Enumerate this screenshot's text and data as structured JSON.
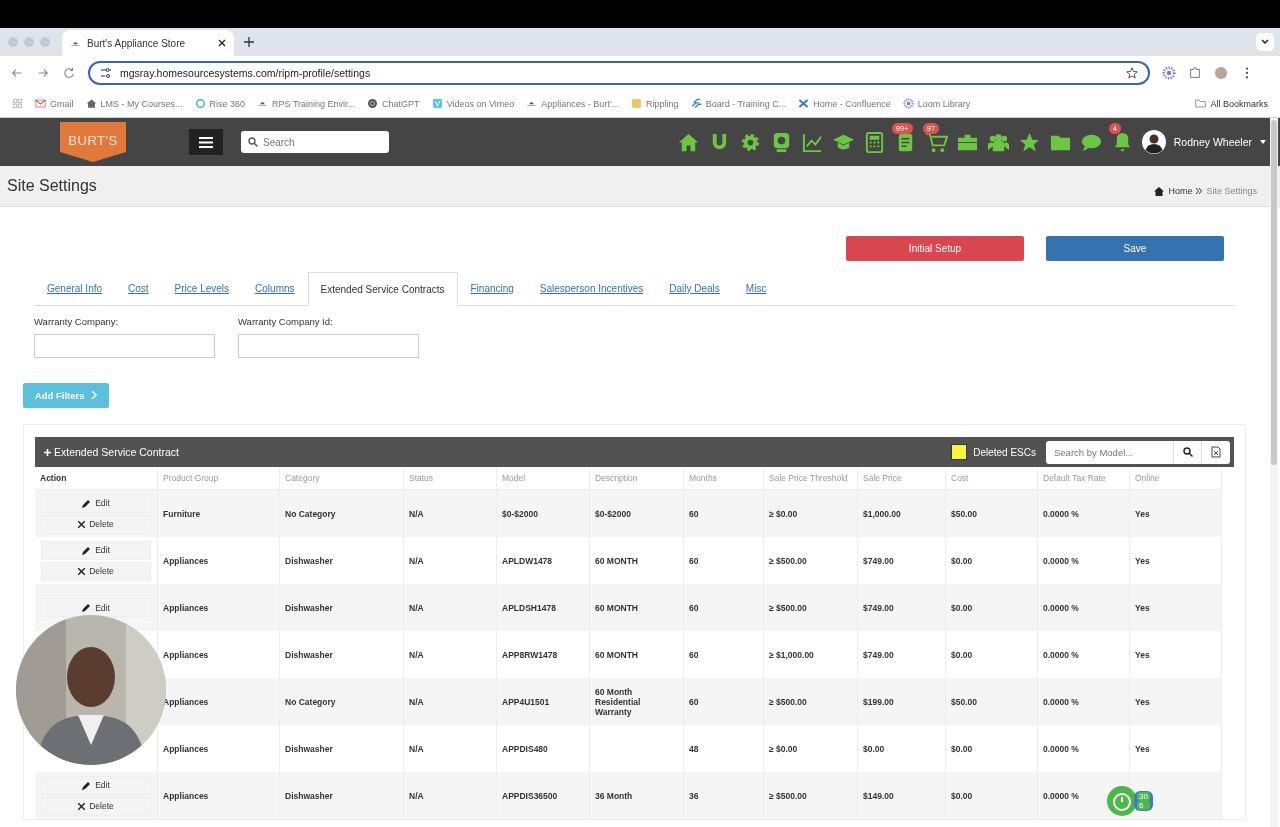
{
  "browser": {
    "tab_title": "Burt's Appliance Store",
    "url": "mgsray.homesourcesystems.com/ripm-profile/settings",
    "bookmarks": [
      {
        "label": "Gmail",
        "kind": "mail"
      },
      {
        "label": "LMS - My Courses...",
        "kind": "house"
      },
      {
        "label": "Rise 360",
        "kind": "ring"
      },
      {
        "label": "RPS Training Envir...",
        "kind": "hat"
      },
      {
        "label": "ChatGPT",
        "kind": "knot"
      },
      {
        "label": "Videos on Vimeo",
        "kind": "video"
      },
      {
        "label": "Appliances - Burt'...",
        "kind": "hat"
      },
      {
        "label": "Rippling",
        "kind": "tile"
      },
      {
        "label": "Board - Training C...",
        "kind": "board"
      },
      {
        "label": "Home - Confluence",
        "kind": "cross"
      },
      {
        "label": "Loom Library",
        "kind": "burst"
      }
    ],
    "all_bookmarks": "All Bookmarks"
  },
  "header": {
    "logo": "BURT'S",
    "search_placeholder": "Search",
    "icons": [
      {
        "kind": "home"
      },
      {
        "kind": "magnet"
      },
      {
        "kind": "gear"
      },
      {
        "kind": "webcam"
      },
      {
        "kind": "chart"
      },
      {
        "kind": "cap"
      },
      {
        "kind": "calculator"
      },
      {
        "kind": "notebook",
        "badge": "99+"
      },
      {
        "kind": "cart",
        "badge": "97"
      },
      {
        "kind": "briefcase"
      },
      {
        "kind": "group"
      },
      {
        "kind": "star"
      },
      {
        "kind": "folder"
      },
      {
        "kind": "chat"
      },
      {
        "kind": "bell",
        "badge": "4"
      }
    ],
    "user": "Rodney Wheeler"
  },
  "page": {
    "title": "Site Settings",
    "breadcrumb": [
      "Home",
      "Site Settings"
    ]
  },
  "buttons": [
    {
      "label": "Initial Setup",
      "kind": "danger"
    },
    {
      "label": "Save",
      "kind": "primary"
    }
  ],
  "tabs": [
    {
      "label": "General Info",
      "selected": false
    },
    {
      "label": "Cost",
      "selected": false
    },
    {
      "label": "Price Levels",
      "selected": false
    },
    {
      "label": "Columns",
      "selected": false
    },
    {
      "label": "Extended Service Contracts",
      "selected": true
    },
    {
      "label": "Financing",
      "selected": false
    },
    {
      "label": "Salesperson Incentives",
      "selected": false
    },
    {
      "label": "Daily Deals",
      "selected": false
    },
    {
      "label": "Misc",
      "selected": false
    }
  ],
  "fields": [
    {
      "label": "Warranty Company:"
    },
    {
      "label": "Warranty Company Id:"
    }
  ],
  "add_filters": "Add Filters",
  "table": {
    "title": "Extended Service Contract",
    "legend": "Deleted ESCs",
    "search_placeholder": "Search by Model...",
    "action_column": "Action",
    "columns": [
      "Product Group",
      "Category",
      "Status",
      "Model",
      "Description",
      "Months",
      "Sale Price Threshold",
      "Sale Price",
      "Cost",
      "Default Tax Rate",
      "Online"
    ],
    "rows": [
      {
        "actions": [
          "Edit",
          "Delete"
        ],
        "cells": [
          "Furniture",
          "No Category",
          "N/A",
          "$0-$2000",
          "$0-$2000",
          "60",
          "≥ $0.00",
          "$1,000.00",
          "$50.00",
          "0.0000 %",
          "Yes"
        ]
      },
      {
        "actions": [
          "Edit",
          "Delete"
        ],
        "cells": [
          "Appliances",
          "Dishwasher",
          "N/A",
          "APLDW1478",
          "60 MONTH",
          "60",
          "≥ $500.00",
          "$749.00",
          "$0.00",
          "0.0000 %",
          "Yes"
        ]
      },
      {
        "actions": [
          "Edit"
        ],
        "cells": [
          "Appliances",
          "Dishwasher",
          "N/A",
          "APLDSH1478",
          "60 MONTH",
          "60",
          "≥ $500.00",
          "$749.00",
          "$0.00",
          "0.0000 %",
          "Yes"
        ]
      },
      {
        "cells": [
          "Appliances",
          "Dishwasher",
          "N/A",
          "APP8RW1478",
          "60 MONTH",
          "60",
          "≥ $1,000.00",
          "$749.00",
          "$0.00",
          "0.0000 %",
          "Yes"
        ]
      },
      {
        "cells": [
          "Appliances",
          "No Category",
          "N/A",
          "APP4U1501",
          "60 Month Residential Warranty",
          "60",
          "≥ $500.00",
          "$199.00",
          "$50.00",
          "0.0000 %",
          "Yes"
        ]
      },
      {
        "cells": [
          "Appliances",
          "Dishwasher",
          "N/A",
          "APPDIS480",
          "",
          "48",
          "≥ $0.00",
          "$0.00",
          "$0.00",
          "0.0000 %",
          "Yes"
        ]
      },
      {
        "actions": [
          "Edit",
          "Delete"
        ],
        "cells": [
          "Appliances",
          "Dishwasher",
          "N/A",
          "APPDIS36500",
          "36 Month",
          "36",
          "≥ $500.00",
          "$149.00",
          "$0.00",
          "0.0000 %",
          ""
        ]
      }
    ]
  },
  "widget": {
    "counts": [
      "30",
      "6"
    ]
  }
}
